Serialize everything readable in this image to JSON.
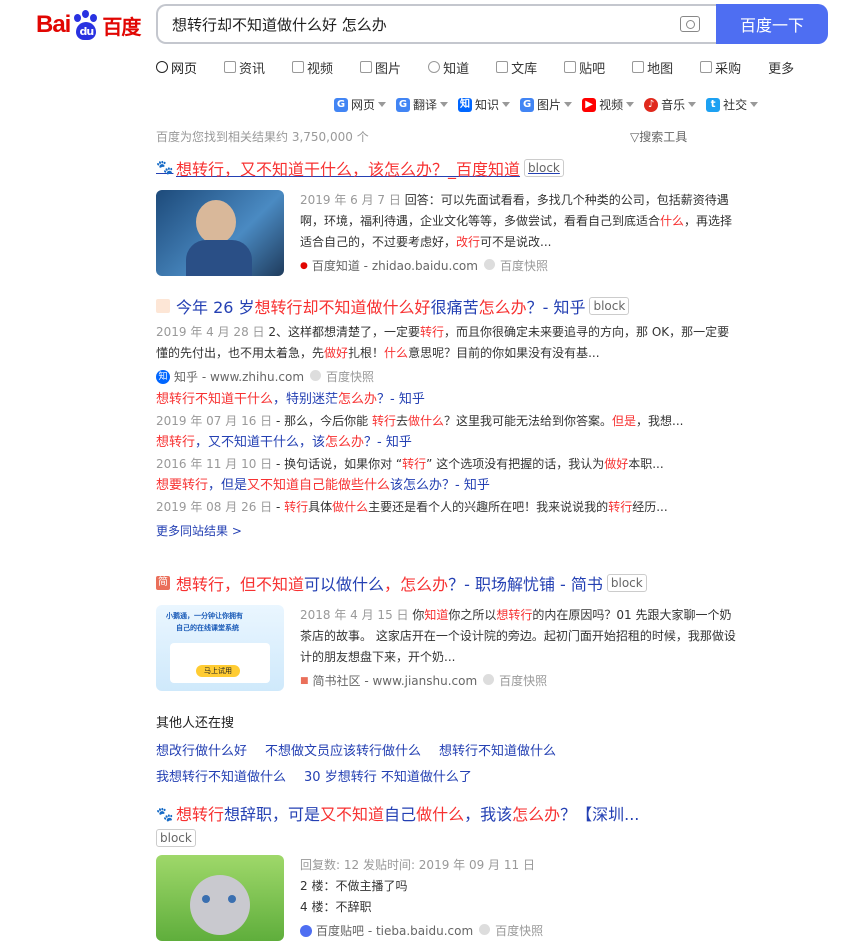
{
  "logo": {
    "bai": "Bai",
    "du": "du",
    "cn": "百度"
  },
  "search": {
    "query": "想转行却不知道做什么好 怎么办",
    "button": "百度一下"
  },
  "tabs": [
    {
      "label": "网页",
      "icon": "search-icon"
    },
    {
      "label": "资讯",
      "icon": "news-icon"
    },
    {
      "label": "视频",
      "icon": "video-icon"
    },
    {
      "label": "图片",
      "icon": "image-icon"
    },
    {
      "label": "知道",
      "icon": "question-icon"
    },
    {
      "label": "文库",
      "icon": "doc-icon"
    },
    {
      "label": "贴吧",
      "icon": "tieba-icon"
    },
    {
      "label": "地图",
      "icon": "map-icon"
    },
    {
      "label": "采购",
      "icon": "purchase-icon"
    },
    {
      "label": "更多",
      "icon": ""
    }
  ],
  "quick": [
    {
      "label": "网页",
      "color": "#4285f4",
      "glyph": "G"
    },
    {
      "label": "翻译",
      "color": "#4285f4",
      "glyph": "G"
    },
    {
      "label": "知识",
      "color": "#0066ff",
      "glyph": "知"
    },
    {
      "label": "图片",
      "color": "#4285f4",
      "glyph": "G"
    },
    {
      "label": "视频",
      "color": "#ff0000",
      "glyph": "▶"
    },
    {
      "label": "音乐",
      "color": "#e0291d",
      "glyph": "♪"
    },
    {
      "label": "社交",
      "color": "#1da1f2",
      "glyph": "t"
    }
  ],
  "stats": "百度为您找到相关结果约 3,750,000 个",
  "tools": "搜索工具",
  "block_label": "block",
  "r1": {
    "t1": "想转行",
    "t2": "，又不知道干什么，该怎么办？_百度知道",
    "date": "2019 年 6 月 7 日",
    "s1": " 回答：可以先面试看看，多找几个种类的公司，包括薪资待遇啊，环境，福利待遇，企业文化等等，多做尝试，看看自己到底适合",
    "s2": "什么",
    "s3": "，再选择适合自己的，不过要考虑好，",
    "s4": "改行",
    "s5": "可不是说改...",
    "source": "百度知道 - zhidao.baidu.com",
    "kuaizhao": "百度快照"
  },
  "r2": {
    "t1": "今年 26 岁 ",
    "t2": "想转行却不知道做什么好",
    "t3": " 很痛苦",
    "t4": "怎么办",
    "t5": "？- 知乎",
    "date": "2019 年 4 月 28 日",
    "s1": " 2、这样都想清楚了，一定要",
    "s2": "转行",
    "s3": "，而且你很确定未来要追寻的方向，那 OK，那一定要懂的先付出，也不用太着急，先",
    "s4": "做好",
    "s5": "扎根！",
    "s6": "什么",
    "s7": "意思呢？目前的你如果没有没有基...",
    "source": "知乎 - www.zhihu.com",
    "kuaizhao": "百度快照",
    "subs": [
      {
        "title_red": "想转行不知道干什么",
        "title_rest": "，特别迷茫",
        "title_red2": "怎么办",
        "title_end": "？- 知乎",
        "date": "2019 年 07 月 16 日",
        "s1": " - 那么，今后你能 ",
        "s2": "转行",
        "s3": "去",
        "s4": "做什么",
        "s5": "？这里我可能无法给到你答案。",
        "s6": "但是",
        "s7": "，我想..."
      },
      {
        "title_red": "想转行",
        "title_rest": "，又不知道干什么，该",
        "title_red2": "怎么办",
        "title_end": "？- 知乎",
        "date": "2016 年 11 月 10 日",
        "s1": " - 换句话说，如果你对 “",
        "s2": "转行",
        "s3": "” 这个选项没有把握的话，我认为",
        "s4": "做好",
        "s5": "本职...",
        "s6": "",
        "s7": ""
      },
      {
        "title_red": "想要转行",
        "title_rest": "，但是",
        "title_red2": "又不知道自己能做些什么",
        "title_end": "该怎么办？- 知乎",
        "date": "2019 年 08 月 26 日",
        "s1": " - ",
        "s2": "转行",
        "s3": "具体",
        "s4": "做什么",
        "s5": "主要还是看个人的兴趣所在吧！我来说说我的",
        "s6": "转行",
        "s7": "经历..."
      }
    ],
    "more": "更多同站结果 >"
  },
  "r3": {
    "t1": "想转行",
    "t2": "，但不知道",
    "t3": "可以做什么",
    "t4": "，",
    "t5": "怎么办",
    "t6": "？- 职场解忧铺 - 简书",
    "date": "2018 年 4 月 15 日",
    "s1": " 你",
    "s2": "知道",
    "s3": "你之所以",
    "s4": "想转行",
    "s5": "的内在原因吗？01 先跟大家聊一个奶茶店的故事。 这家店开在一个设计院的旁边。起初门面开始招租的时候，我那做设计的朋友想盘下来，开个奶...",
    "source": "简书社区 - www.jianshu.com",
    "kuaizhao": "百度快照",
    "thumb_text1": "小鹅通，一分钟让你拥有",
    "thumb_text2": "自己的在线课堂系统",
    "thumb_btn": "马上试用"
  },
  "related": {
    "title": "其他人还在搜",
    "row1": [
      "想改行做什么好",
      "不想做文员应该转行做什么",
      "想转行不知道做什么"
    ],
    "row2": [
      "我想转行不知道做什么",
      "30 岁想转行 不知道做什么了"
    ]
  },
  "r4": {
    "t1": "想转行",
    "t2": "想辞职，可是",
    "t3": "又不知道",
    "t4": "自己",
    "t5": "做什么",
    "t6": "，我该",
    "t7": "怎么办",
    "t8": "？【深圳...",
    "meta": "回复数: 12 发贴时间: 2019 年 09 月 11 日",
    "l1": "2 楼：不做主播了吗",
    "l2": "4 楼：不辞职",
    "source": "百度贴吧 - tieba.baidu.com",
    "kuaizhao": "百度快照"
  }
}
